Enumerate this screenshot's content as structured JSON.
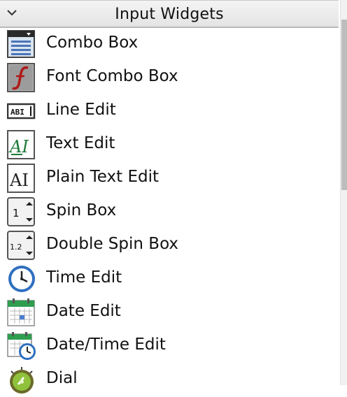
{
  "section": {
    "title": "Input Widgets",
    "toggle_icon": "chevron-down-icon"
  },
  "items": [
    {
      "label": "Combo Box",
      "icon": "combo-box-icon"
    },
    {
      "label": "Font Combo Box",
      "icon": "font-combo-box-icon"
    },
    {
      "label": "Line Edit",
      "icon": "line-edit-icon"
    },
    {
      "label": "Text Edit",
      "icon": "text-edit-icon"
    },
    {
      "label": "Plain Text Edit",
      "icon": "plain-text-edit-icon"
    },
    {
      "label": "Spin Box",
      "icon": "spin-box-icon"
    },
    {
      "label": "Double Spin Box",
      "icon": "double-spin-box-icon"
    },
    {
      "label": "Time Edit",
      "icon": "time-edit-icon"
    },
    {
      "label": "Date Edit",
      "icon": "date-edit-icon"
    },
    {
      "label": "Date/Time Edit",
      "icon": "date-time-edit-icon"
    },
    {
      "label": "Dial",
      "icon": "dial-icon"
    }
  ],
  "icon_text": {
    "line_edit": "ABI",
    "text_edit": "AI",
    "plain_text_edit": "AI",
    "spin_box": "1",
    "double_spin_box": "1.2"
  }
}
